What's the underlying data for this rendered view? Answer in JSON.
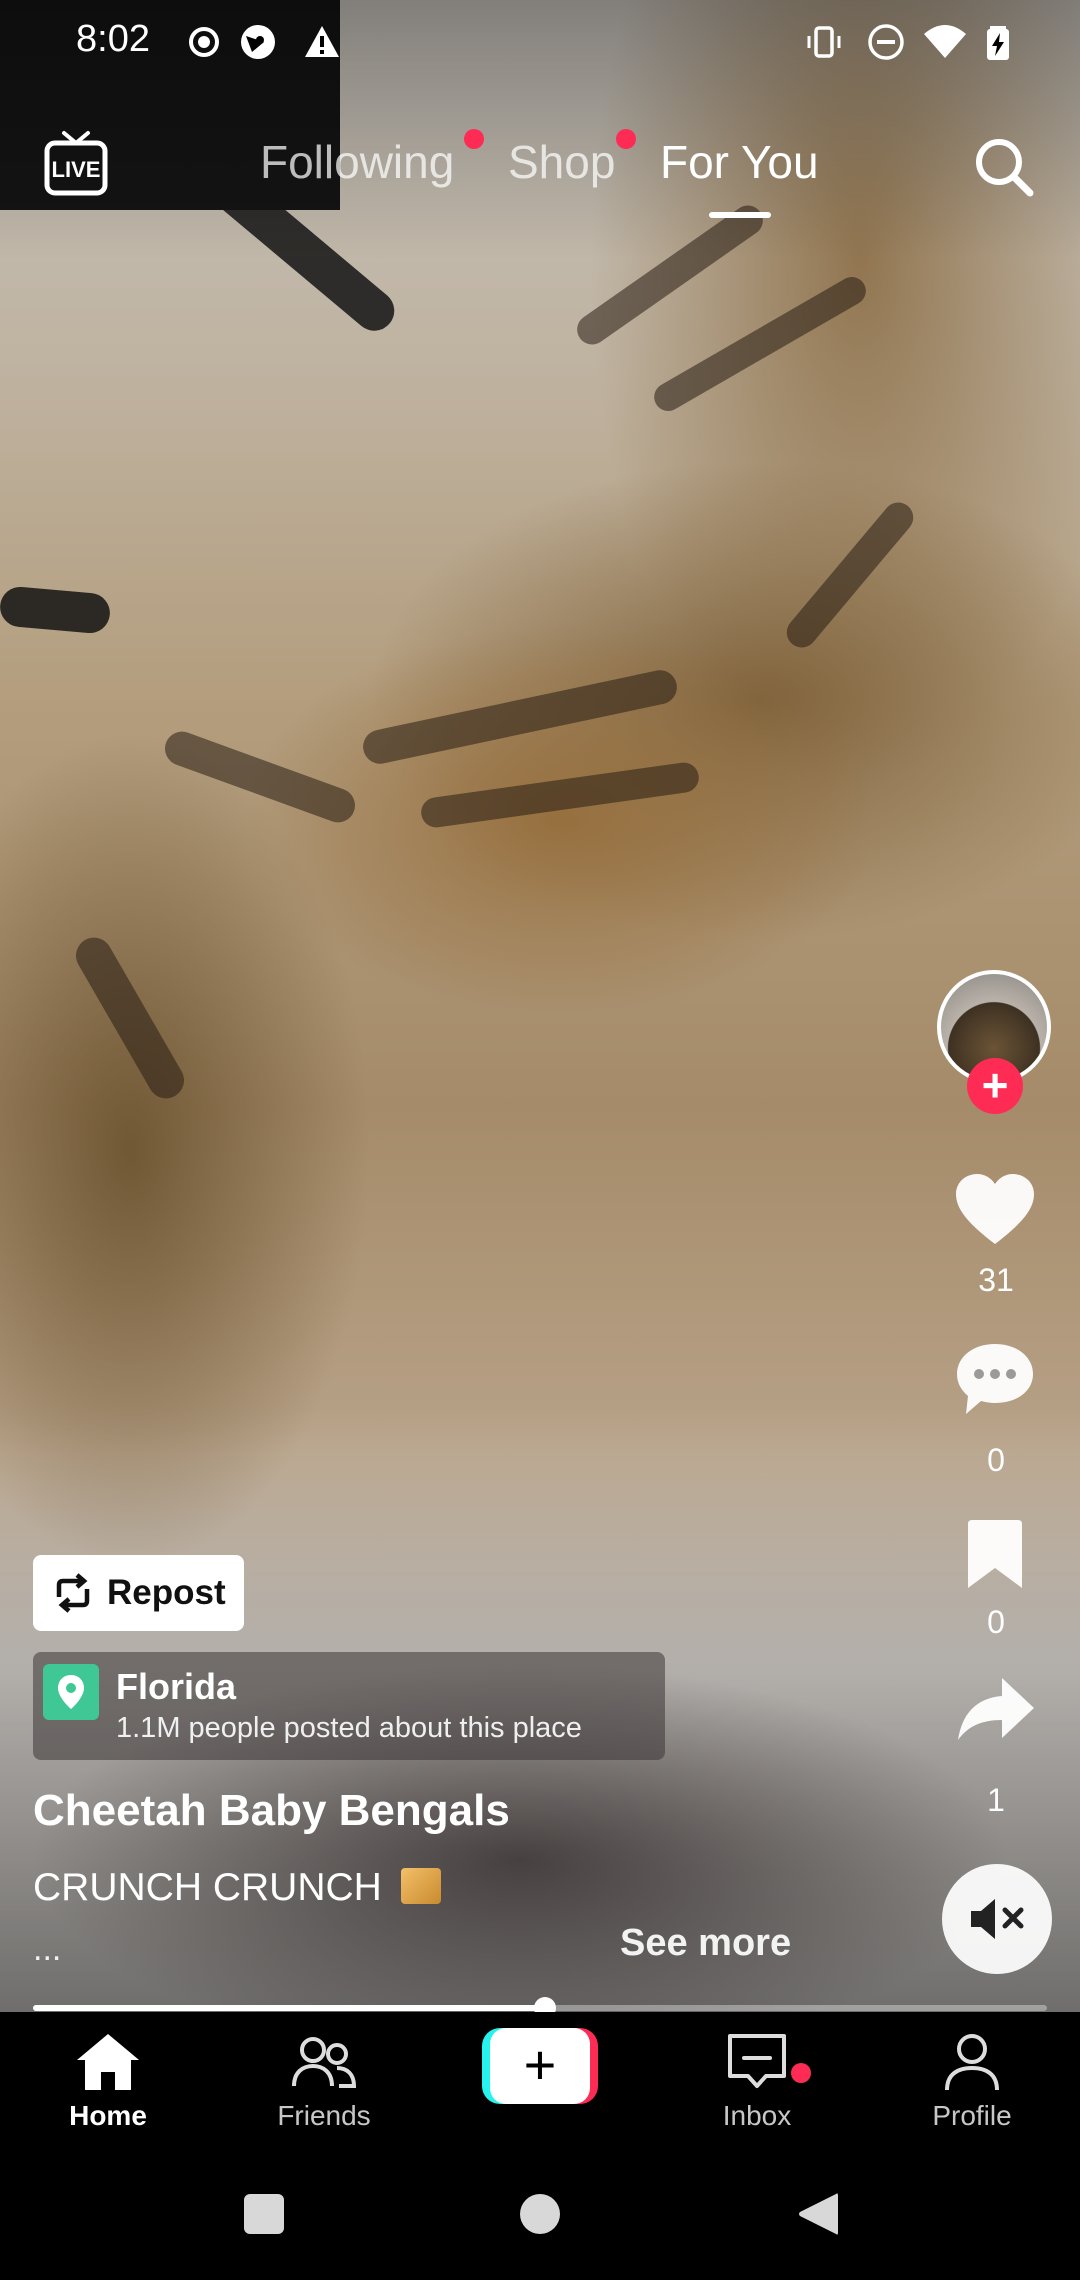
{
  "status_bar": {
    "time": "8:02",
    "left_icons": [
      "record-icon",
      "browser-icon",
      "warning-icon"
    ],
    "right_icons": [
      "vibrate-icon",
      "do-not-disturb-icon",
      "wifi-icon",
      "battery-charging-icon"
    ]
  },
  "top_nav": {
    "live_label": "LIVE",
    "tabs": [
      {
        "label": "Following",
        "has_dot": true
      },
      {
        "label": "Shop",
        "has_dot": true
      },
      {
        "label": "For You",
        "active": true
      }
    ]
  },
  "actions": {
    "likes": "31",
    "comments": "0",
    "saves": "0",
    "shares": "1"
  },
  "post": {
    "repost_label": "Repost",
    "location": {
      "name": "Florida",
      "subtitle": "1.1M people posted about this place"
    },
    "author": "Cheetah Baby Bengals",
    "caption": "CRUNCH CRUNCH",
    "caption_emoji": "package-emoji",
    "ellipsis": "...",
    "see_more": "See more"
  },
  "playback": {
    "progress_fraction": 0.505,
    "muted": true
  },
  "bottom_nav": {
    "items": [
      {
        "label": "Home",
        "active": true
      },
      {
        "label": "Friends"
      },
      {
        "label": "Inbox",
        "has_dot": true
      },
      {
        "label": "Profile"
      }
    ]
  },
  "colors": {
    "accent": "#fe2c55",
    "create_cyan": "#25f4ee",
    "location_pin": "#3fc795"
  }
}
